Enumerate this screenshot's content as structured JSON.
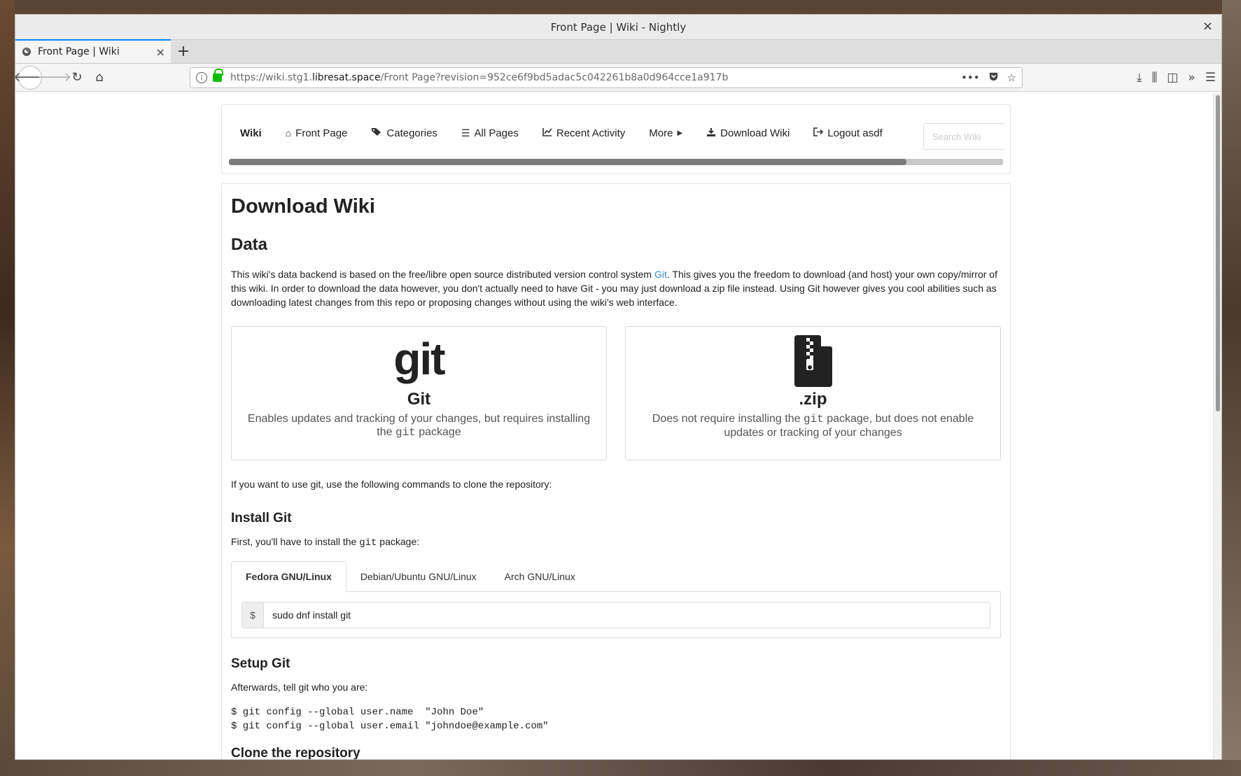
{
  "window": {
    "title": "Front Page | Wiki - Nightly",
    "close_glyph": "×"
  },
  "tab": {
    "label": "Front Page | Wiki",
    "close_glyph": "×",
    "new_tab_glyph": "+"
  },
  "urlbar": {
    "url_prefix": "https://wiki.stg1.",
    "url_domain": "libresat.space",
    "url_path": "/Front Page?revision=952ce6f9bd5adac5c042261b8a0d964cce1a917b"
  },
  "wiki_nav": {
    "brand": "Wiki",
    "items": [
      {
        "label": "Front Page",
        "icon": "home-icon"
      },
      {
        "label": "Categories",
        "icon": "tags-icon"
      },
      {
        "label": "All Pages",
        "icon": "list-icon"
      },
      {
        "label": "Recent Activity",
        "icon": "chart-icon"
      },
      {
        "label": "More",
        "icon": "caret-right-icon"
      },
      {
        "label": "Download Wiki",
        "icon": "download-icon"
      },
      {
        "label": "Logout  asdf",
        "icon": "logout-icon"
      }
    ],
    "search_placeholder": "Search Wiki"
  },
  "content": {
    "title": "Download Wiki",
    "data_heading": "Data",
    "intro_before_link": "This wiki's data backend is based on the free/libre open source distributed version control system ",
    "intro_link": "Git",
    "intro_after_link": ". This gives you the freedom to download (and host) your own copy/mirror of this wiki. In order to download the data however, you don't actually need to have Git - you may just download a zip file instead. Using Git however gives you cool abilities such as downloading latest changes from this repo or proposing changes without using the wiki's web interface.",
    "cards": {
      "git": {
        "logo_text": "git",
        "title": "Git",
        "desc_before": "Enables updates and tracking of your changes, but requires installing the ",
        "desc_code": "git",
        "desc_after": " package"
      },
      "zip": {
        "title": ".zip",
        "desc_before": "Does not require installing the ",
        "desc_code": "git",
        "desc_after": " package, but does not enable updates or tracking of your changes"
      }
    },
    "clone_intro": "If you want to use git, use the following commands to clone the repository:",
    "install_heading": "Install Git",
    "install_text_before": "First, you'll have to install the ",
    "install_text_code": "git",
    "install_text_after": " package:",
    "os_tabs": [
      "Fedora GNU/Linux",
      "Debian/Ubuntu GNU/Linux",
      "Arch GNU/Linux"
    ],
    "prompt": "$",
    "install_command": "sudo dnf install git",
    "setup_heading": "Setup Git",
    "setup_text": "Afterwards, tell git who you are:",
    "setup_code_line1": "$ git config --global user.name  \"John Doe\"",
    "setup_code_line2": "$ git config --global user.email \"johndoe@example.com\"",
    "clone_heading": "Clone the repository"
  }
}
